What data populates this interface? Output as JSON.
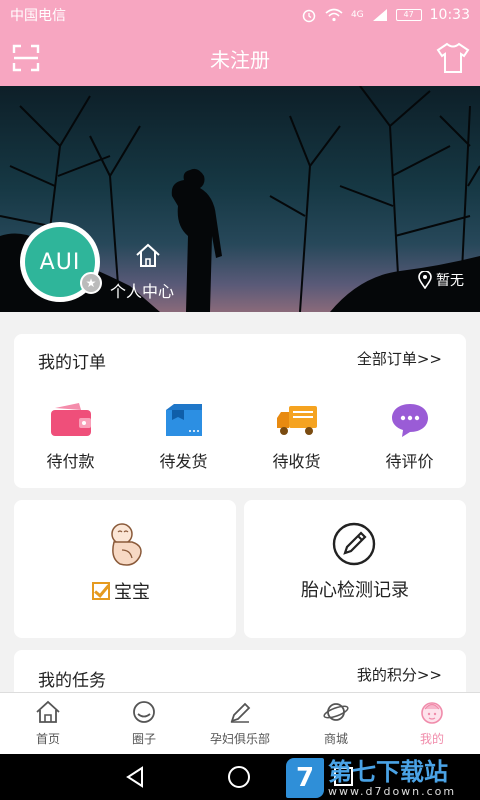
{
  "statusbar": {
    "carrier": "中国电信",
    "network": "4G",
    "battery": "47",
    "time": "10:33"
  },
  "header": {
    "title": "未注册",
    "left_icon": "scan-icon",
    "right_icon": "tshirt-icon"
  },
  "profile": {
    "avatar_text": "AUI",
    "personal_center": "个人中心",
    "location": "暂无"
  },
  "orders": {
    "title": "我的订单",
    "all_link": "全部订单>>",
    "items": [
      {
        "label": "待付款",
        "icon": "wallet-icon",
        "color": "#ef4f7a"
      },
      {
        "label": "待发货",
        "icon": "package-icon",
        "color": "#2c8fe3"
      },
      {
        "label": "待收货",
        "icon": "truck-icon",
        "color": "#f5a320"
      },
      {
        "label": "待评价",
        "icon": "chat-bubble-icon",
        "color": "#9a5cd6"
      }
    ]
  },
  "baby": {
    "label": "宝宝",
    "checked": true
  },
  "fetal": {
    "label": "胎心检测记录"
  },
  "tasks": {
    "title": "我的任务",
    "points_link": "我的积分>>"
  },
  "tabs": [
    {
      "label": "首页",
      "icon": "home-icon"
    },
    {
      "label": "圈子",
      "icon": "circle-chat-icon"
    },
    {
      "label": "孕妇俱乐部",
      "icon": "pencil-icon"
    },
    {
      "label": "商城",
      "icon": "planet-icon"
    },
    {
      "label": "我的",
      "icon": "baby-face-icon",
      "active": true
    }
  ],
  "watermark": {
    "logo": "7",
    "title": "第七下载站",
    "url": "www.d7down.com"
  },
  "colors": {
    "brand_pink": "#f7a6c1",
    "active_tab": "#f08cab",
    "avatar_green": "#2fb59a"
  }
}
